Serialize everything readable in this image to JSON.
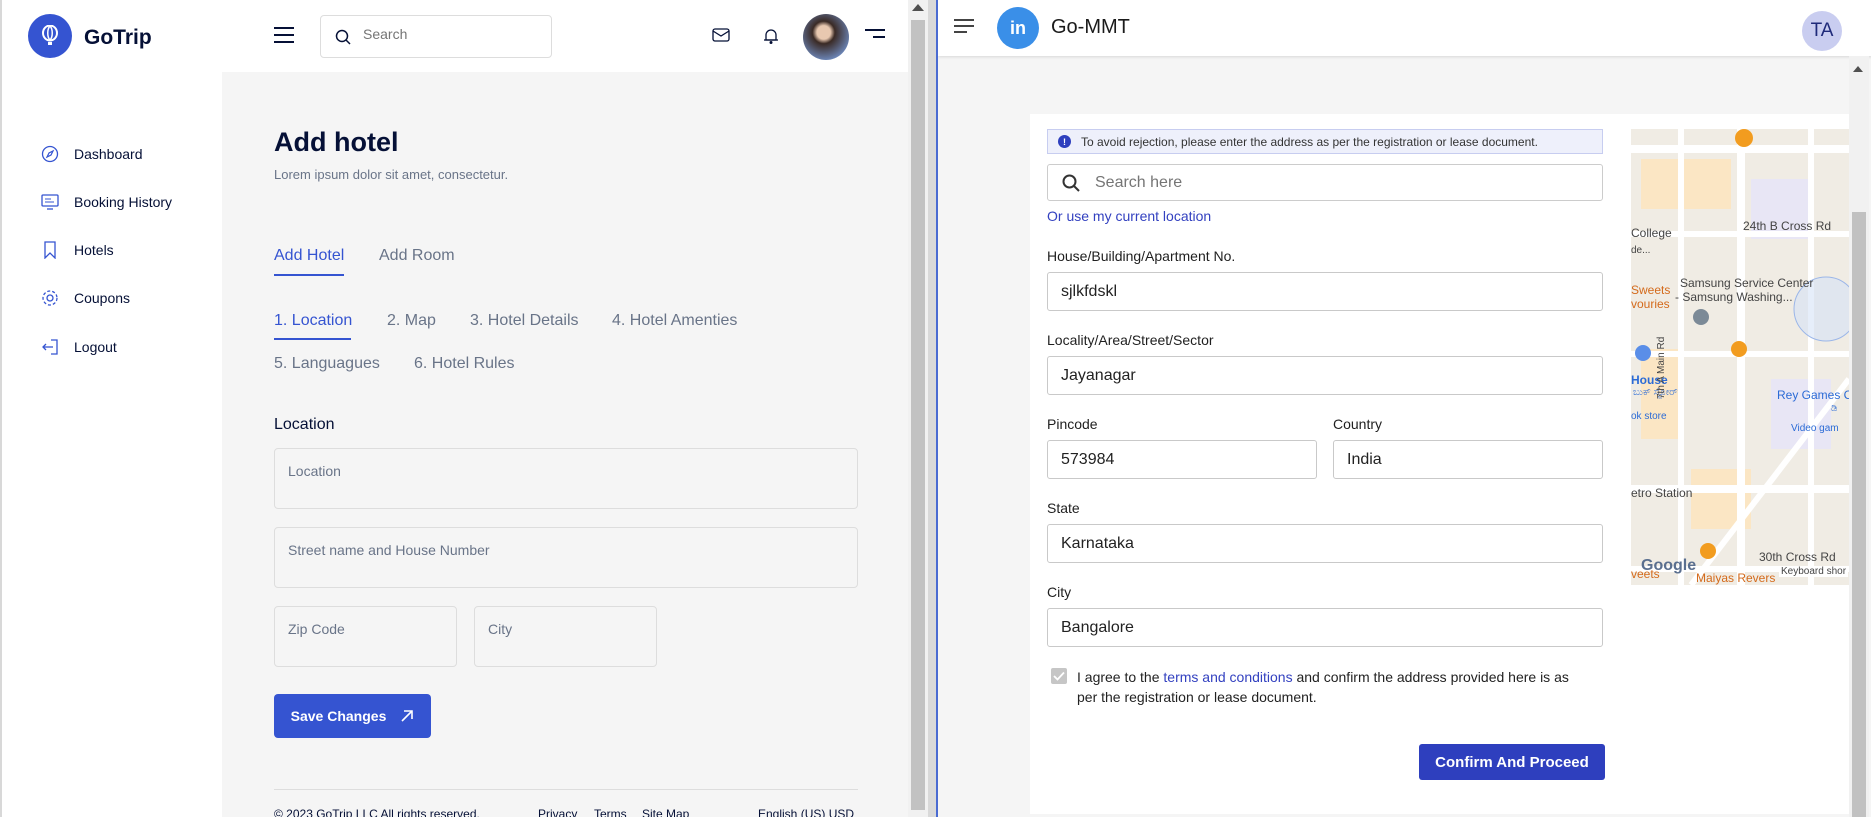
{
  "left": {
    "brand": "GoTrip",
    "search_placeholder": "Search",
    "sidebar": [
      {
        "label": "Dashboard",
        "icon": "compass-icon"
      },
      {
        "label": "Booking History",
        "icon": "monitor-icon"
      },
      {
        "label": "Hotels",
        "icon": "bookmark-icon"
      },
      {
        "label": "Coupons",
        "icon": "gear-icon"
      },
      {
        "label": "Logout",
        "icon": "logout-icon"
      }
    ],
    "title": "Add hotel",
    "subtitle": "Lorem ipsum dolor sit amet, consectetur.",
    "tabs": [
      "Add Hotel",
      "Add Room"
    ],
    "steps": [
      "1. Location",
      "2. Map",
      "3. Hotel Details",
      "4. Hotel Amenties",
      "5. Languagues",
      "6. Hotel Rules"
    ],
    "section": "Location",
    "fields": {
      "location": "Location",
      "street": "Street name and House Number",
      "zip": "Zip Code",
      "city": "City"
    },
    "save_label": "Save Changes",
    "footer": {
      "copyright": "© 2023 GoTrip LLC All rights reserved.",
      "privacy": "Privacy",
      "terms": "Terms",
      "sitemap": "Site Map",
      "locale": "English (US) USD"
    }
  },
  "right": {
    "logo_letters": "in",
    "app_title": "Go-MMT",
    "avatar": "TA",
    "notice": "To avoid rejection, please enter the address as per the registration or lease document.",
    "search_placeholder": "Search here",
    "current_location": "Or use my current location",
    "house_label": "House/Building/Apartment No.",
    "house_value": "sjlkfdskl",
    "locality_label": "Locality/Area/Street/Sector",
    "locality_value": "Jayanagar",
    "pincode_label": "Pincode",
    "pincode_value": "573984",
    "country_label": "Country",
    "country_value": "India",
    "state_label": "State",
    "state_value": "Karnataka",
    "city_label": "City",
    "city_value": "Bangalore",
    "agree_prefix": "I agree to the ",
    "agree_link": "terms and conditions",
    "agree_suffix": " and confirm the address provided here is as per the registration or lease document.",
    "confirm_label": "Confirm And Proceed",
    "map_labels": {
      "college": "College",
      "de": "de...",
      "cross24": "24th B Cross Rd",
      "sweets": "Sweets",
      "vouries": "vouries",
      "samsung1": "Samsung Service Center",
      "samsung2": "- Samsung Washing...",
      "house": "House",
      "kannada": "ಬುಕ್ ಸ್ಟೋರ್",
      "ok_store": "ok store",
      "main_rd": "7th A Main Rd",
      "rey": "Rey Games C",
      "rey_kn": "ಡಿ",
      "video": "Video gam",
      "metro": "etro Station",
      "cross30": "30th Cross Rd",
      "google": "Google",
      "keyboard": "Keyboard shor",
      "veets": "veets",
      "maiyas": "Maiyas Revers"
    }
  }
}
